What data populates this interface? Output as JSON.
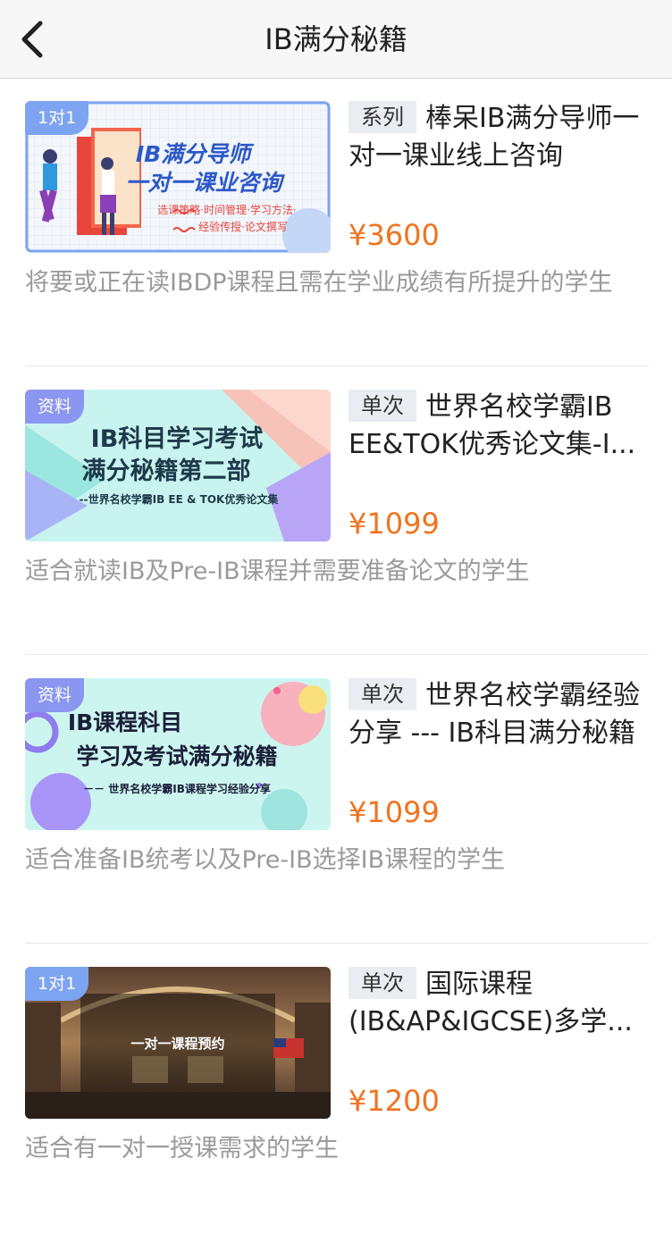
{
  "nav": {
    "title": "IB满分秘籍"
  },
  "colors": {
    "price": "#f0731f",
    "tag_bg": "#7da4f0",
    "badge_bg": "#e9ecf1",
    "desc": "#9a9a9a"
  },
  "courses": [
    {
      "tag": "1对1",
      "badge": "系列",
      "title_line1": "棒呆IB满分导师一",
      "title_line2": "对一课业线上咨询",
      "price": "¥3600",
      "desc": "将要或正在读IBDP课程且需在学业成绩有所提升的学生",
      "banner": {
        "line1": "IB满分导师",
        "line2": "一对一课业咨询",
        "sub1": "选课策略·时间管理·学习方法·",
        "sub2": "经验传授·论文撰写"
      }
    },
    {
      "tag": "资料",
      "badge": "单次",
      "title_line1": "世界名校学霸IB",
      "title_line2": "EE&TOK优秀论文集-I...",
      "price": "¥1099",
      "desc": "适合就读IB及Pre-IB课程并需要准备论文的学生",
      "banner": {
        "line1": "IB科目学习考试",
        "line2": "满分秘籍第二部",
        "sub1": "--世界名校学霸IB EE & TOK优秀论文集"
      }
    },
    {
      "tag": "资料",
      "badge": "单次",
      "title_line1": "世界名校学霸经验",
      "title_line2": "分享 --- IB科目满分秘籍",
      "price": "¥1099",
      "desc": "适合准备IB统考以及Pre-IB选择IB课程的学生",
      "banner": {
        "line1": "IB课程科目",
        "line2": "学习及考试满分秘籍",
        "sub1": "－－ 世界名校学霸IB课程学习经验分享"
      }
    },
    {
      "tag": "1对1",
      "badge": "单次",
      "title_line1": "国际课程",
      "title_line2": "(IB&AP&IGCSE)多学...",
      "price": "¥1200",
      "desc": "适合有一对一授课需求的学生",
      "banner": {
        "line1": "一对一课程预约"
      }
    }
  ]
}
